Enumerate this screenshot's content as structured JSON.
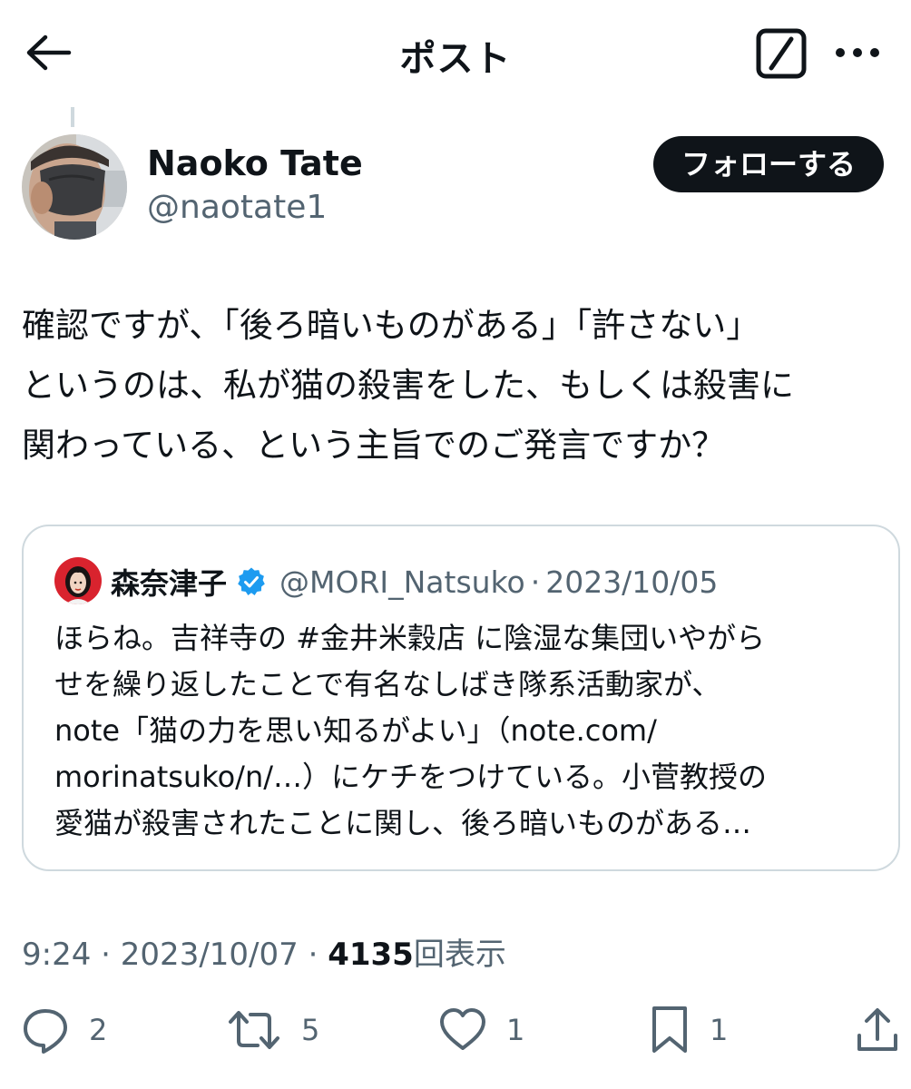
{
  "header": {
    "title": "ポスト",
    "back_icon": "arrow-left-icon",
    "grok_icon": "grok-icon",
    "more_icon": "more-horizontal-icon"
  },
  "author": {
    "display_name": "Naoko Tate",
    "handle": "@naotate1",
    "follow_label": "フォローする"
  },
  "tweet": {
    "lines": [
      "確認ですが、「後ろ暗いものがある」「許さない」",
      "というのは、私が猫の殺害をした、もしくは殺害に",
      "関わっている、という主旨でのご発言ですか？"
    ]
  },
  "quote": {
    "display_name": "森奈津子",
    "verified_icon": "verified-badge-icon",
    "handle": "@MORI_Natsuko",
    "separator": "·",
    "date": "2023/10/05",
    "lines": [
      "ほらね。吉祥寺の #金井米穀店 に陰湿な集団いやがら",
      "せを繰り返したことで有名なしばき隊系活動家が、",
      "note「猫の力を思い知るがよい」（note.com/",
      "morinatsuko/n/…）にケチをつけている。小菅教授の",
      "愛猫が殺害されたことに関し、後ろ暗いものがある…"
    ]
  },
  "meta": {
    "time": "9:24",
    "separator": "·",
    "date": "2023/10/07",
    "views": "4135",
    "views_label": "回表示"
  },
  "actions": {
    "reply_count": "2",
    "retweet_count": "5",
    "like_count": "1",
    "bookmark_count": "1"
  },
  "colors": {
    "text": "#0f1419",
    "secondary": "#536471",
    "border": "#cfd9de",
    "verified": "#1d9bf0",
    "follow_bg": "#0f1419"
  }
}
